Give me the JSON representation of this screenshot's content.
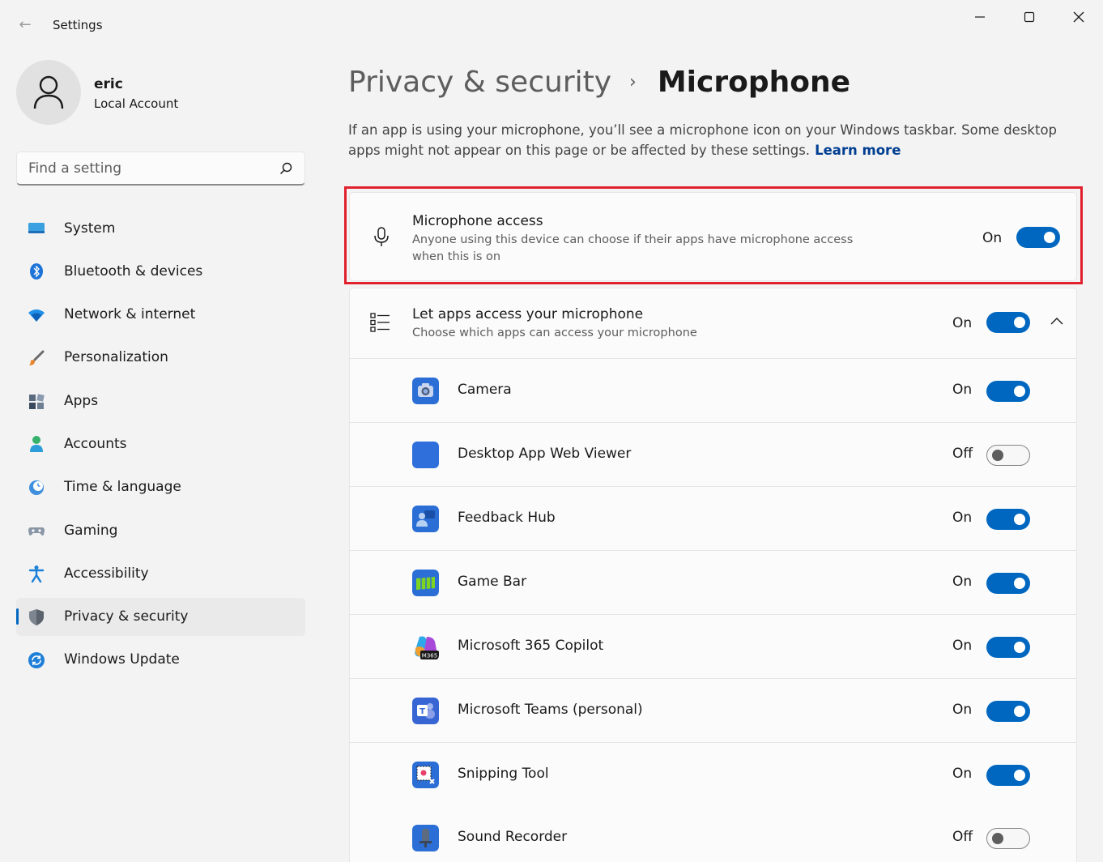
{
  "window": {
    "title": "Settings",
    "back_glyph": "←"
  },
  "profile": {
    "name": "eric",
    "account_type": "Local Account"
  },
  "search": {
    "placeholder": "Find a setting"
  },
  "sidebar": {
    "items": [
      {
        "label": "System",
        "icon": "system-icon",
        "selected": false
      },
      {
        "label": "Bluetooth & devices",
        "icon": "bluetooth-icon",
        "selected": false
      },
      {
        "label": "Network & internet",
        "icon": "wifi-icon",
        "selected": false
      },
      {
        "label": "Personalization",
        "icon": "brush-icon",
        "selected": false
      },
      {
        "label": "Apps",
        "icon": "apps-icon",
        "selected": false
      },
      {
        "label": "Accounts",
        "icon": "accounts-icon",
        "selected": false
      },
      {
        "label": "Time & language",
        "icon": "clock-globe-icon",
        "selected": false
      },
      {
        "label": "Gaming",
        "icon": "gamepad-icon",
        "selected": false
      },
      {
        "label": "Accessibility",
        "icon": "accessibility-icon",
        "selected": false
      },
      {
        "label": "Privacy & security",
        "icon": "shield-icon",
        "selected": true
      },
      {
        "label": "Windows Update",
        "icon": "update-icon",
        "selected": false
      }
    ]
  },
  "header": {
    "parent": "Privacy & security",
    "separator": "›",
    "current": "Microphone"
  },
  "description": {
    "text": "If an app is using your microphone, you’ll see a microphone icon on your Windows taskbar. Some desktop apps might not appear on this page or be affected by these settings.",
    "link": "Learn more"
  },
  "mic_access": {
    "title": "Microphone access",
    "subtitle_line1": "Anyone using this device can choose if their apps have microphone access",
    "subtitle_line2": "when this is on",
    "state": "On",
    "on": true
  },
  "apps_access": {
    "title": "Let apps access your microphone",
    "subtitle": "Choose which apps can access your microphone",
    "state": "On",
    "on": true,
    "expanded": true
  },
  "apps": [
    {
      "name": "Camera",
      "state": "On",
      "on": true,
      "icon": "camera-app-icon",
      "color": "#2b6fd6"
    },
    {
      "name": "Desktop App Web Viewer",
      "state": "Off",
      "on": false,
      "icon": "web-viewer-app-icon",
      "color": "#2f6fdc"
    },
    {
      "name": "Feedback Hub",
      "state": "On",
      "on": true,
      "icon": "feedback-hub-app-icon",
      "color": "#2b6fd6"
    },
    {
      "name": "Game Bar",
      "state": "On",
      "on": true,
      "icon": "game-bar-app-icon",
      "color": "#2b6fd6"
    },
    {
      "name": "Microsoft 365 Copilot",
      "state": "On",
      "on": true,
      "icon": "m365-copilot-app-icon",
      "color": "#7b4fd8"
    },
    {
      "name": "Microsoft Teams (personal)",
      "state": "On",
      "on": true,
      "icon": "teams-app-icon",
      "color": "#3766d4"
    },
    {
      "name": "Snipping Tool",
      "state": "On",
      "on": true,
      "icon": "snipping-tool-app-icon",
      "color": "#2b6fd6"
    },
    {
      "name": "Sound Recorder",
      "state": "Off",
      "on": false,
      "icon": "sound-recorder-app-icon",
      "color": "#2b6fd6"
    }
  ],
  "m365_badge": "M365",
  "teams_badge": "T",
  "colors": {
    "accent": "#0067c0",
    "highlight": "#e0202d",
    "background": "#f3f3f3",
    "card": "#fbfbfb"
  }
}
